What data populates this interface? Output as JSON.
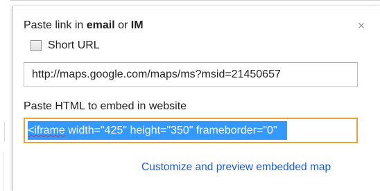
{
  "dialog": {
    "title_prefix": "Paste link in ",
    "title_email": "email",
    "title_or": " or ",
    "title_im": "IM",
    "close_glyph": "×",
    "short_url": {
      "label": "Short URL",
      "checked": false
    },
    "link_value": "http://maps.google.com/maps/ms?msid=21450657",
    "embed_label": "Paste HTML to embed in website",
    "embed_value_tag": "<iframe",
    "embed_value_rest": " width=\"425\" height=\"350\" frameborder=\"0\" ",
    "customize_link": "Customize and preview embedded map"
  },
  "colors": {
    "link": "#1a5ccf",
    "focus_border": "#e8a33a",
    "selection": "#3399ff"
  },
  "icons": {
    "close": "close-icon"
  }
}
